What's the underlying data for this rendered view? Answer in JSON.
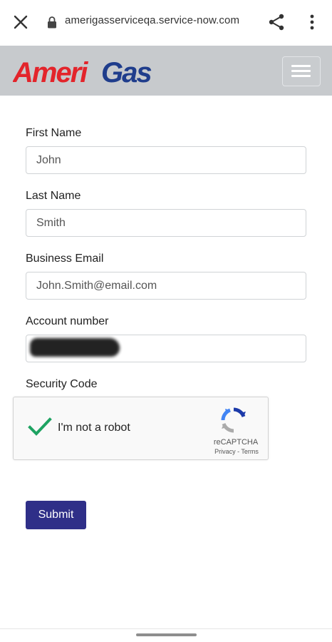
{
  "browser": {
    "url": "amerigasserviceqa.service-now.com"
  },
  "header": {
    "logo_text": "AmeriGas"
  },
  "form": {
    "first_name_label": "First Name",
    "first_name_value": "John",
    "last_name_label": "Last Name",
    "last_name_value": "Smith",
    "email_label": "Business Email",
    "email_value": "John.Smith@email.com",
    "account_label": "Account number",
    "account_value": "",
    "security_label": "Security Code",
    "submit_label": "Submit"
  },
  "captcha": {
    "text": "I'm not a robot",
    "brand": "reCAPTCHA",
    "terms": "Privacy - Terms",
    "checked": true
  },
  "colors": {
    "header_bg": "#c7cacd",
    "logo_red": "#e3242b",
    "logo_blue": "#1f3d8c",
    "submit_bg": "#2f2f88",
    "check_green": "#1ea362"
  }
}
